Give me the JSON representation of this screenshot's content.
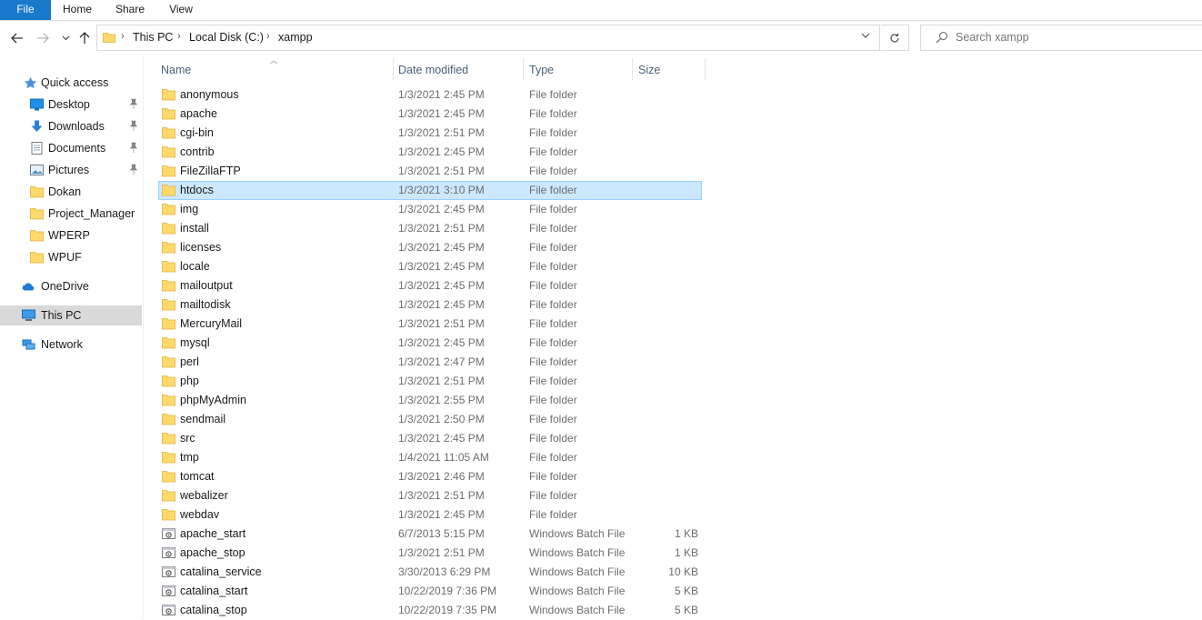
{
  "ribbon": {
    "tabs": [
      "File",
      "Home",
      "Share",
      "View"
    ]
  },
  "address": {
    "crumbs": [
      "This PC",
      "Local Disk (C:)",
      "xampp"
    ]
  },
  "search": {
    "placeholder": "Search xampp"
  },
  "nav": {
    "quick_access": "Quick access",
    "items": [
      {
        "label": "Desktop",
        "icon": "desktop-icon",
        "pinned": true
      },
      {
        "label": "Downloads",
        "icon": "downloads-icon",
        "pinned": true
      },
      {
        "label": "Documents",
        "icon": "documents-icon",
        "pinned": true
      },
      {
        "label": "Pictures",
        "icon": "pictures-icon",
        "pinned": true
      },
      {
        "label": "Dokan",
        "icon": "folder-icon",
        "pinned": false
      },
      {
        "label": "Project_Manager",
        "icon": "folder-icon",
        "pinned": false
      },
      {
        "label": "WPERP",
        "icon": "folder-icon",
        "pinned": false
      },
      {
        "label": "WPUF",
        "icon": "folder-icon",
        "pinned": false
      }
    ],
    "onedrive": "OneDrive",
    "thispc": "This PC",
    "network": "Network"
  },
  "columns": {
    "name": "Name",
    "date": "Date modified",
    "type": "Type",
    "size": "Size"
  },
  "files": [
    {
      "name": "anonymous",
      "date": "1/3/2021 2:45 PM",
      "type": "File folder",
      "size": "",
      "kind": "folder"
    },
    {
      "name": "apache",
      "date": "1/3/2021 2:45 PM",
      "type": "File folder",
      "size": "",
      "kind": "folder"
    },
    {
      "name": "cgi-bin",
      "date": "1/3/2021 2:51 PM",
      "type": "File folder",
      "size": "",
      "kind": "folder"
    },
    {
      "name": "contrib",
      "date": "1/3/2021 2:45 PM",
      "type": "File folder",
      "size": "",
      "kind": "folder"
    },
    {
      "name": "FileZillaFTP",
      "date": "1/3/2021 2:51 PM",
      "type": "File folder",
      "size": "",
      "kind": "folder"
    },
    {
      "name": "htdocs",
      "date": "1/3/2021 3:10 PM",
      "type": "File folder",
      "size": "",
      "kind": "folder",
      "selected": true
    },
    {
      "name": "img",
      "date": "1/3/2021 2:45 PM",
      "type": "File folder",
      "size": "",
      "kind": "folder"
    },
    {
      "name": "install",
      "date": "1/3/2021 2:51 PM",
      "type": "File folder",
      "size": "",
      "kind": "folder"
    },
    {
      "name": "licenses",
      "date": "1/3/2021 2:45 PM",
      "type": "File folder",
      "size": "",
      "kind": "folder"
    },
    {
      "name": "locale",
      "date": "1/3/2021 2:45 PM",
      "type": "File folder",
      "size": "",
      "kind": "folder"
    },
    {
      "name": "mailoutput",
      "date": "1/3/2021 2:45 PM",
      "type": "File folder",
      "size": "",
      "kind": "folder"
    },
    {
      "name": "mailtodisk",
      "date": "1/3/2021 2:45 PM",
      "type": "File folder",
      "size": "",
      "kind": "folder"
    },
    {
      "name": "MercuryMail",
      "date": "1/3/2021 2:51 PM",
      "type": "File folder",
      "size": "",
      "kind": "folder"
    },
    {
      "name": "mysql",
      "date": "1/3/2021 2:45 PM",
      "type": "File folder",
      "size": "",
      "kind": "folder"
    },
    {
      "name": "perl",
      "date": "1/3/2021 2:47 PM",
      "type": "File folder",
      "size": "",
      "kind": "folder"
    },
    {
      "name": "php",
      "date": "1/3/2021 2:51 PM",
      "type": "File folder",
      "size": "",
      "kind": "folder"
    },
    {
      "name": "phpMyAdmin",
      "date": "1/3/2021 2:55 PM",
      "type": "File folder",
      "size": "",
      "kind": "folder"
    },
    {
      "name": "sendmail",
      "date": "1/3/2021 2:50 PM",
      "type": "File folder",
      "size": "",
      "kind": "folder"
    },
    {
      "name": "src",
      "date": "1/3/2021 2:45 PM",
      "type": "File folder",
      "size": "",
      "kind": "folder"
    },
    {
      "name": "tmp",
      "date": "1/4/2021 11:05 AM",
      "type": "File folder",
      "size": "",
      "kind": "folder"
    },
    {
      "name": "tomcat",
      "date": "1/3/2021 2:46 PM",
      "type": "File folder",
      "size": "",
      "kind": "folder"
    },
    {
      "name": "webalizer",
      "date": "1/3/2021 2:51 PM",
      "type": "File folder",
      "size": "",
      "kind": "folder"
    },
    {
      "name": "webdav",
      "date": "1/3/2021 2:45 PM",
      "type": "File folder",
      "size": "",
      "kind": "folder"
    },
    {
      "name": "apache_start",
      "date": "6/7/2013 5:15 PM",
      "type": "Windows Batch File",
      "size": "1 KB",
      "kind": "batch"
    },
    {
      "name": "apache_stop",
      "date": "1/3/2021 2:51 PM",
      "type": "Windows Batch File",
      "size": "1 KB",
      "kind": "batch"
    },
    {
      "name": "catalina_service",
      "date": "3/30/2013 6:29 PM",
      "type": "Windows Batch File",
      "size": "10 KB",
      "kind": "batch"
    },
    {
      "name": "catalina_start",
      "date": "10/22/2019 7:36 PM",
      "type": "Windows Batch File",
      "size": "5 KB",
      "kind": "batch"
    },
    {
      "name": "catalina_stop",
      "date": "10/22/2019 7:35 PM",
      "type": "Windows Batch File",
      "size": "5 KB",
      "kind": "batch"
    }
  ]
}
